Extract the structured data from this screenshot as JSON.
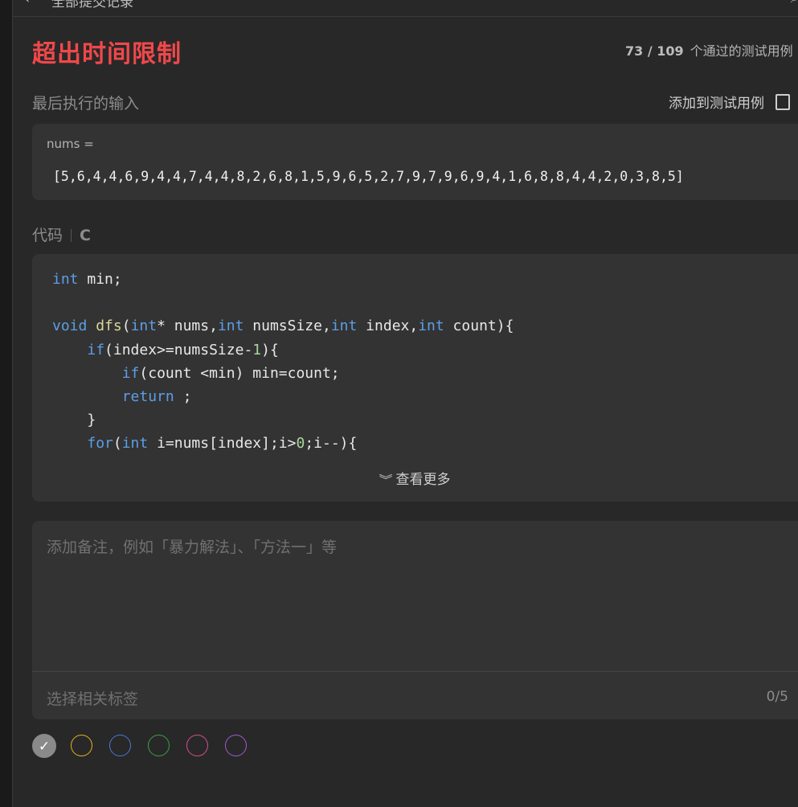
{
  "topbar": {
    "title": "全部提交记录",
    "back_icon": "‹",
    "search_icon": "⌕"
  },
  "status": {
    "title": "超出时间限制",
    "passed": "73 / 109",
    "passed_suffix": "个通过的测试用例"
  },
  "last_input": {
    "label": "最后执行的输入",
    "add_label": "添加到测试用例",
    "var": "nums =",
    "value": "[5,6,4,4,6,9,4,4,7,4,4,8,2,6,8,1,5,9,6,5,2,7,9,7,9,6,9,4,1,6,8,8,4,4,2,0,3,8,5]"
  },
  "code": {
    "label": "代码",
    "lang": "C",
    "see_more": "查看更多",
    "lines": [
      "int min;",
      "",
      "void dfs(int* nums,int numsSize,int index,int count){",
      "    if(index>=numsSize-1){",
      "        if(count <min) min=count;",
      "        return ;",
      "    }",
      "    for(int i=nums[index];i>0;i--){"
    ]
  },
  "note": {
    "placeholder": "添加备注，例如「暴力解法」、「方法一」等",
    "tag_placeholder": "选择相关标签",
    "tag_count": "0/5"
  },
  "colors": {
    "dots": [
      "#8a8a8a",
      "#e6b422",
      "#4a78d6",
      "#3aa14a",
      "#d6508a",
      "#a15ad6"
    ],
    "status": "#f0484a"
  }
}
